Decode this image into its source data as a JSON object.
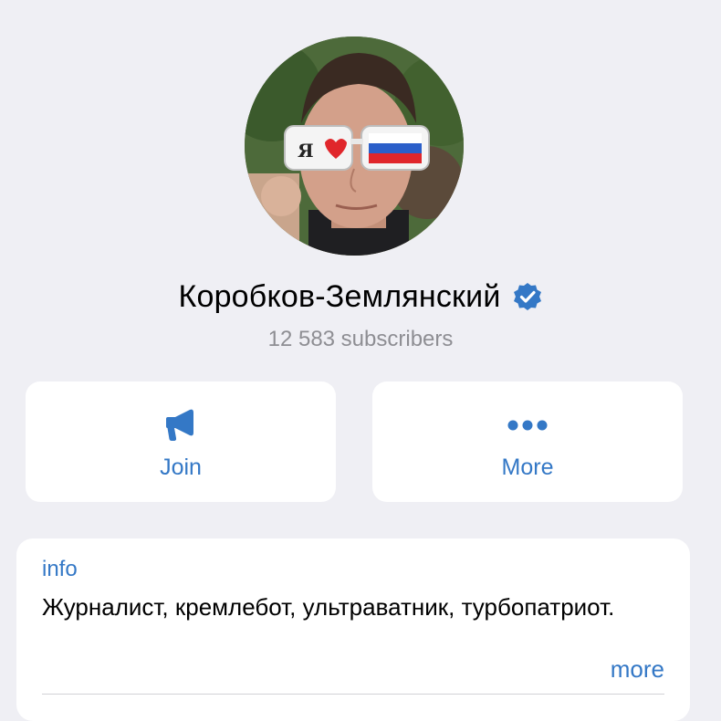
{
  "channel": {
    "name": "Коробков-Землянский",
    "subscribers": "12 583 subscribers"
  },
  "actions": {
    "join": {
      "label": "Join",
      "icon": "megaphone-icon"
    },
    "more": {
      "label": "More",
      "icon": "ellipsis-icon"
    }
  },
  "info": {
    "label": "info",
    "description": "Журналист, кремлебот, ультраватник, турбопатриот.",
    "more_link": "more"
  },
  "colors": {
    "accent": "#3478c6",
    "background": "#efeff4",
    "card": "#ffffff",
    "secondary_text": "#8e8e93"
  },
  "avatar": {
    "glasses_print": "Я"
  }
}
